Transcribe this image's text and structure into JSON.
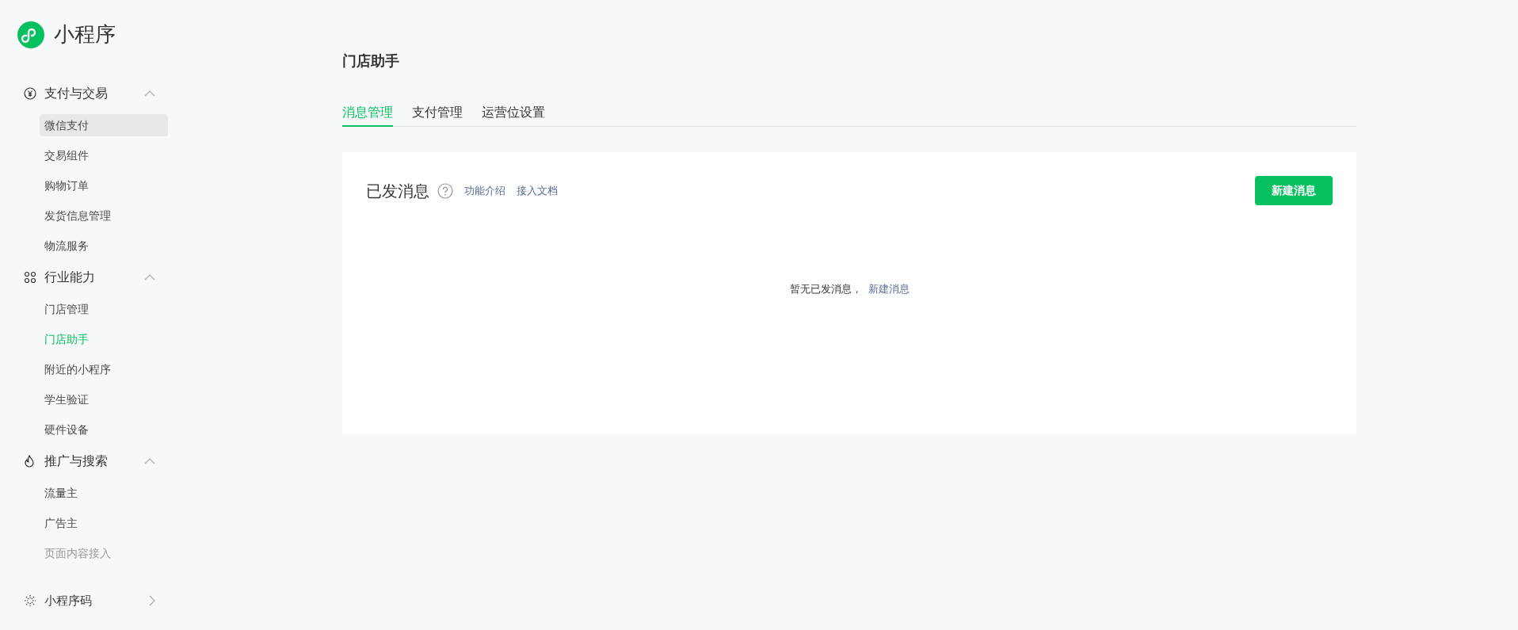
{
  "brand": {
    "title": "小程序"
  },
  "sidebar": {
    "groups": [
      {
        "kind": "yen",
        "label": "支付与交易",
        "expanded": true,
        "items": [
          {
            "label": "微信支付",
            "selected": false,
            "highlighted": true,
            "faded": false
          },
          {
            "label": "交易组件",
            "selected": false,
            "highlighted": false,
            "faded": false
          },
          {
            "label": "购物订单",
            "selected": false,
            "highlighted": false,
            "faded": false
          },
          {
            "label": "发货信息管理",
            "selected": false,
            "highlighted": false,
            "faded": false
          },
          {
            "label": "物流服务",
            "selected": false,
            "highlighted": false,
            "faded": false
          }
        ]
      },
      {
        "kind": "nodes",
        "label": "行业能力",
        "expanded": true,
        "items": [
          {
            "label": "门店管理",
            "selected": false,
            "highlighted": false,
            "faded": false
          },
          {
            "label": "门店助手",
            "selected": true,
            "highlighted": false,
            "faded": false
          },
          {
            "label": "附近的小程序",
            "selected": false,
            "highlighted": false,
            "faded": false
          },
          {
            "label": "学生验证",
            "selected": false,
            "highlighted": false,
            "faded": false
          },
          {
            "label": "硬件设备",
            "selected": false,
            "highlighted": false,
            "faded": false
          }
        ]
      },
      {
        "kind": "flame",
        "label": "推广与搜索",
        "expanded": true,
        "items": [
          {
            "label": "流量主",
            "selected": false,
            "highlighted": false,
            "faded": false
          },
          {
            "label": "广告主",
            "selected": false,
            "highlighted": false,
            "faded": false
          },
          {
            "label": "页面内容接入",
            "selected": false,
            "highlighted": false,
            "faded": true
          }
        ]
      },
      {
        "kind": "code",
        "label": "小程序码",
        "expanded": false
      }
    ]
  },
  "page": {
    "title": "门店助手",
    "tabs": [
      {
        "label": "消息管理",
        "selected": true
      },
      {
        "label": "支付管理",
        "selected": false
      },
      {
        "label": "运营位设置",
        "selected": false
      }
    ],
    "card": {
      "title": "已发消息",
      "links": [
        "功能介绍",
        "接入文档"
      ],
      "button": "新建消息",
      "empty_text": "暂无已发消息，",
      "empty_link": "新建消息"
    }
  }
}
